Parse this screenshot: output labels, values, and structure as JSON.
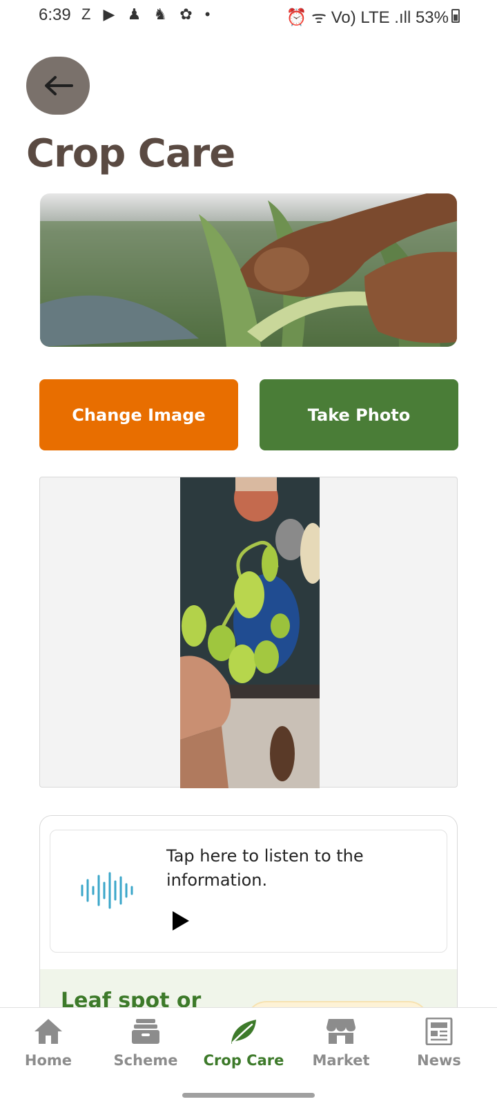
{
  "status_bar": {
    "time": "6:39",
    "left_icons": "Z ▶ ♟ ♞ ✿ •",
    "right_text": "⏰ ᯤ Vo) LTE .ıll 53%",
    "battery_percent": 53
  },
  "header": {
    "back_icon": "arrow-left-icon",
    "title": "Crop Care"
  },
  "actions": {
    "change_image_label": "Change Image",
    "take_photo_label": "Take Photo"
  },
  "audio": {
    "text": "Tap here to listen to the information."
  },
  "result": {
    "disease_name": "Leaf spot or"
  },
  "bottom_nav": {
    "items": [
      {
        "label": "Home",
        "icon": "home-icon",
        "active": false
      },
      {
        "label": "Scheme",
        "icon": "scheme-icon",
        "active": false
      },
      {
        "label": "Crop Care",
        "icon": "leaf-icon",
        "active": true
      },
      {
        "label": "Market",
        "icon": "store-icon",
        "active": false
      },
      {
        "label": "News",
        "icon": "news-icon",
        "active": false
      }
    ]
  },
  "colors": {
    "orange": "#e86e00",
    "green": "#4a7d37",
    "title_brown": "#5a4a42",
    "active_nav": "#3d7a2a"
  }
}
